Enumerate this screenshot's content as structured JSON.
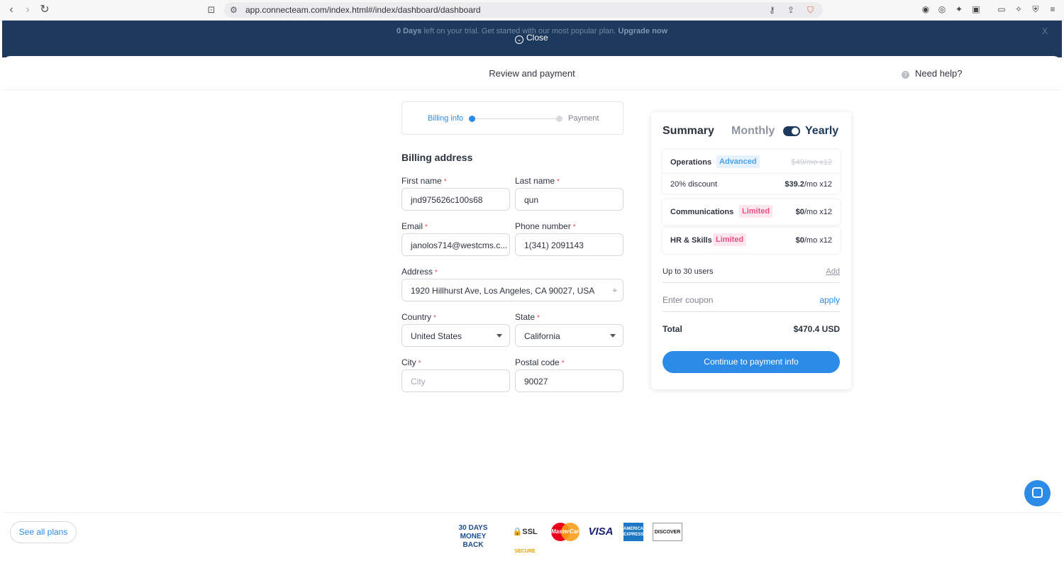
{
  "browser": {
    "url": "app.connecteam.com/index.html#/index/dashboard/dashboard",
    "back": "‹",
    "forward": "›",
    "reload": "↻",
    "bookmark_icon": "bookmark-icon"
  },
  "banner": {
    "days": "0 Days",
    "text": " left on your trial. Get started with our most popular plan. ",
    "upgrade": "Upgrade now",
    "x": "X",
    "close_label": "Close",
    "close_icon": "⌄"
  },
  "modal": {
    "title": "Review and payment",
    "help_icon": "?",
    "help": "Need help?"
  },
  "stepper": {
    "step1": "Billing info",
    "step2": "Payment"
  },
  "form": {
    "section_title": "Billing address",
    "first_name": {
      "label": "First name",
      "value": "jnd975626c100s68"
    },
    "last_name": {
      "label": "Last name",
      "value": "qun"
    },
    "email": {
      "label": "Email",
      "value": "janolos714@westcms.c..."
    },
    "phone": {
      "label": "Phone number",
      "value": "1(341) 2091143"
    },
    "address": {
      "label": "Address",
      "value": "1920 Hillhurst Ave, Los Angeles, CA 90027, USA"
    },
    "country": {
      "label": "Country",
      "value": "United States"
    },
    "state": {
      "label": "State",
      "value": "California"
    },
    "city": {
      "label": "City",
      "placeholder": "City",
      "value": ""
    },
    "postal": {
      "label": "Postal code",
      "value": "90027"
    },
    "required_mark": "*"
  },
  "summary": {
    "title": "Summary",
    "monthly": "Monthly",
    "yearly": "Yearly",
    "billing_period": "yearly",
    "plans": [
      {
        "name": "Operations",
        "tier": "Advanced",
        "original": "$49/mo x12",
        "discount_label": "20% discount",
        "price": "$39.2",
        "unit": "/mo x12"
      },
      {
        "name": "Communications",
        "tier": "Limited",
        "price": "$0",
        "unit": "/mo x12"
      },
      {
        "name": "HR & Skills",
        "tier": "Limited",
        "price": "$0",
        "unit": "/mo x12"
      }
    ],
    "users": "Up to 30 users",
    "add": "Add",
    "coupon_placeholder": "Enter coupon",
    "apply": "apply",
    "total_label": "Total",
    "total_value": "$470.4 USD",
    "cta": "Continue to payment info"
  },
  "footer": {
    "see_plans": "See all plans",
    "badges": {
      "money_back": "30 DAYS MONEY BACK",
      "ssl": "SSL",
      "ssl_sub": "SECURE",
      "mastercard": "MasterCard",
      "visa": "VISA",
      "amex": "AMERICAN EXPRESS",
      "discover": "DISCOVER"
    }
  },
  "colors": {
    "accent": "#2b8be6",
    "banner": "#1d3a5c",
    "tag_advanced": "#4aa3ea",
    "tag_limited": "#e94f86"
  }
}
